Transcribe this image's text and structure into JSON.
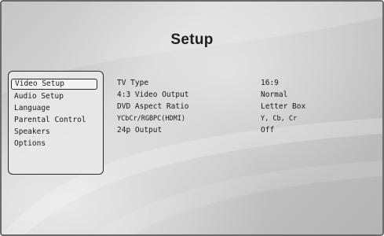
{
  "screen": {
    "title": "Setup"
  },
  "menu": {
    "items": [
      {
        "label": "Video Setup",
        "selected": true
      },
      {
        "label": "Audio Setup",
        "selected": false
      },
      {
        "label": "Language",
        "selected": false
      },
      {
        "label": "Parental Control",
        "selected": false
      },
      {
        "label": "Speakers",
        "selected": false
      },
      {
        "label": "Options",
        "selected": false
      }
    ]
  },
  "settings": [
    {
      "label": "TV Type",
      "value": "16:9"
    },
    {
      "label": "4:3 Video Output",
      "value": "Normal"
    },
    {
      "label": "DVD Aspect Ratio",
      "value": "Letter Box"
    },
    {
      "label": "YCbCr/RGBPC(HDMI)",
      "value": "Y, Cb, Cr"
    },
    {
      "label": "24p Output",
      "value": "Off"
    }
  ],
  "colors": {
    "background": "#c4c4c4",
    "text": "#1a1a1a",
    "panel_border": "#2b2b2b"
  }
}
